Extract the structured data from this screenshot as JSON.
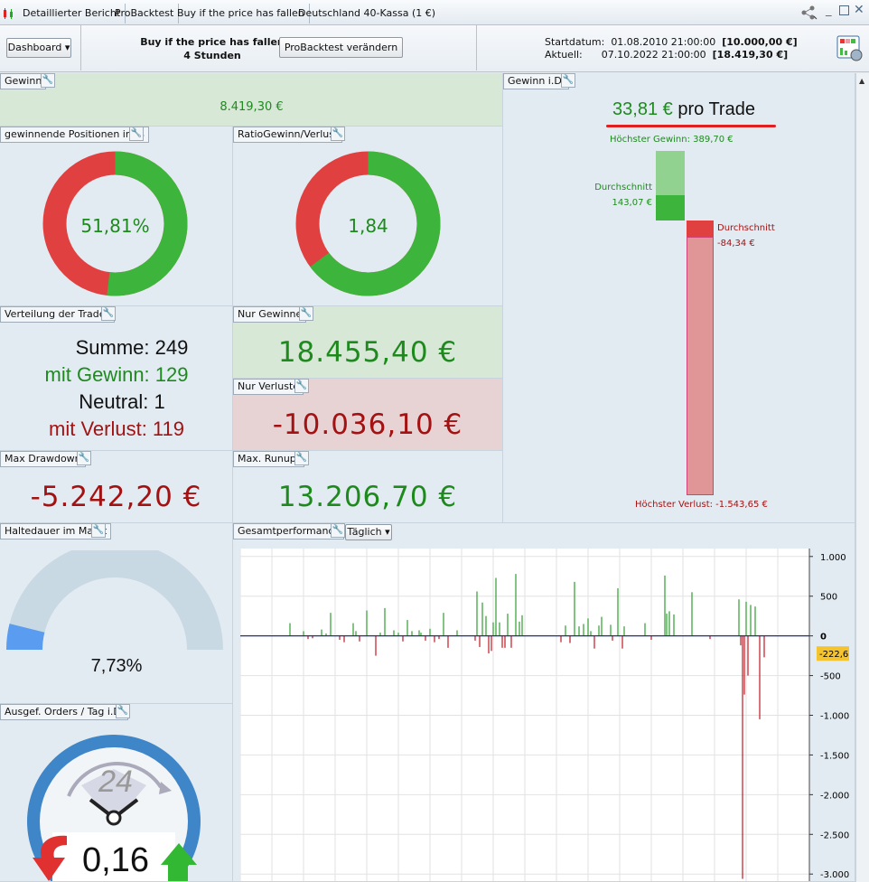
{
  "tabs": [
    "Detaillierter Bericht",
    "ProBacktest",
    "Buy if the price has fallen",
    "Deutschland 40-Kassa (1 €)"
  ],
  "header": {
    "dashboard": "Dashboard",
    "strategy_name": "Buy if the price has fallen",
    "timeframe": "4 Stunden",
    "modify_button": "ProBacktest verändern",
    "start_label": "Startdatum:",
    "start_value": "01.08.2010 21:00:00",
    "start_amount": "[10.000,00 €]",
    "current_label": "Aktuell:",
    "current_value": "07.10.2022 21:00:00",
    "current_amount": "[18.419,30 €]"
  },
  "gewinn": {
    "title": "Gewinn",
    "value": "8.419,30 €"
  },
  "win_pct": {
    "title": "gewinnende Positionen in %",
    "value": "51,81%",
    "fraction": 0.5181
  },
  "ratio": {
    "title": "RatioGewinn/Verlust",
    "value": "1,84",
    "fraction": 0.648
  },
  "verteilung": {
    "title": "Verteilung der Trades",
    "summe": "Summe: 249",
    "gewinn": "mit Gewinn: 129",
    "neutral": "Neutral: 1",
    "verlust": "mit Verlust: 119"
  },
  "nur_gewinne": {
    "title": "Nur Gewinne",
    "value": "18.455,40 €"
  },
  "nur_verluste": {
    "title": "Nur Verluste",
    "value": "-10.036,10 €"
  },
  "max_drawdown": {
    "title": "Max Drawdown",
    "value": "-5.242,20 €"
  },
  "max_runup": {
    "title": "Max. Runup:",
    "value": "13.206,70 €"
  },
  "gewinn_id": {
    "title": "Gewinn i.D.",
    "per_trade_value": "33,81 €",
    "per_trade_label": "pro Trade",
    "highest_gain": "Höchster Gewinn: 389,70 €",
    "avg_gain_label": "Durchschnitt",
    "avg_gain_value": "143,07 €",
    "avg_loss_label": "Durchschnitt",
    "avg_loss_value": "-84,34 €",
    "highest_loss": "Höchster Verlust: -1.543,65 €"
  },
  "haltedauer": {
    "title": "Haltedauer im Markt",
    "value": "7,73%",
    "fraction": 0.0773
  },
  "orders": {
    "title": "Ausgef. Orders / Tag i.D.",
    "value": "0,16",
    "clock_label": "24"
  },
  "gesamt": {
    "title": "Gesamtperformance",
    "period": "Täglich",
    "current": "-222,6"
  },
  "colors": {
    "green": "#3db53d",
    "red": "#e04040",
    "profit_text": "#1e8a1e",
    "loss_text": "#a31212"
  },
  "chart_data": {
    "type": "bar",
    "title": "",
    "xlabel": "",
    "ylabel": "",
    "ylim": [
      -3100,
      1100
    ],
    "yticks": [
      "1.000",
      "500",
      "0",
      "-500",
      "-1.000",
      "-1.500",
      "-2.000",
      "-2.500",
      "-3.000"
    ],
    "ytick_values": [
      1000,
      500,
      0,
      -500,
      -1000,
      -1500,
      -2000,
      -2500,
      -3000
    ],
    "x": [
      55,
      70,
      75,
      80,
      90,
      95,
      100,
      110,
      115,
      125,
      128,
      132,
      140,
      150,
      155,
      160,
      170,
      175,
      180,
      185,
      190,
      198,
      200,
      205,
      210,
      215,
      220,
      225,
      230,
      240,
      260,
      262,
      265,
      268,
      272,
      275,
      278,
      280,
      283,
      287,
      290,
      293,
      296,
      300,
      305,
      309,
      312,
      355,
      360,
      365,
      370,
      375,
      380,
      385,
      388,
      392,
      397,
      400,
      410,
      412,
      418,
      423,
      425,
      448,
      455,
      470,
      472,
      475,
      480,
      500,
      520,
      552,
      554,
      556,
      558,
      560,
      562,
      565,
      570,
      575,
      580
    ],
    "values": [
      160,
      60,
      -40,
      -30,
      80,
      30,
      290,
      -50,
      -80,
      160,
      60,
      -70,
      320,
      -250,
      40,
      350,
      70,
      40,
      -70,
      200,
      60,
      70,
      40,
      -60,
      90,
      -80,
      -40,
      290,
      -150,
      70,
      -60,
      560,
      -140,
      420,
      250,
      -220,
      -190,
      170,
      730,
      170,
      -150,
      -150,
      280,
      -150,
      780,
      180,
      260,
      -80,
      130,
      -90,
      680,
      120,
      150,
      220,
      60,
      -160,
      130,
      240,
      140,
      -60,
      600,
      -160,
      120,
      160,
      -50,
      760,
      280,
      310,
      270,
      550,
      -40,
      460,
      -120,
      -3060,
      -740,
      430,
      -500,
      390,
      370,
      -1050,
      -270
    ]
  }
}
